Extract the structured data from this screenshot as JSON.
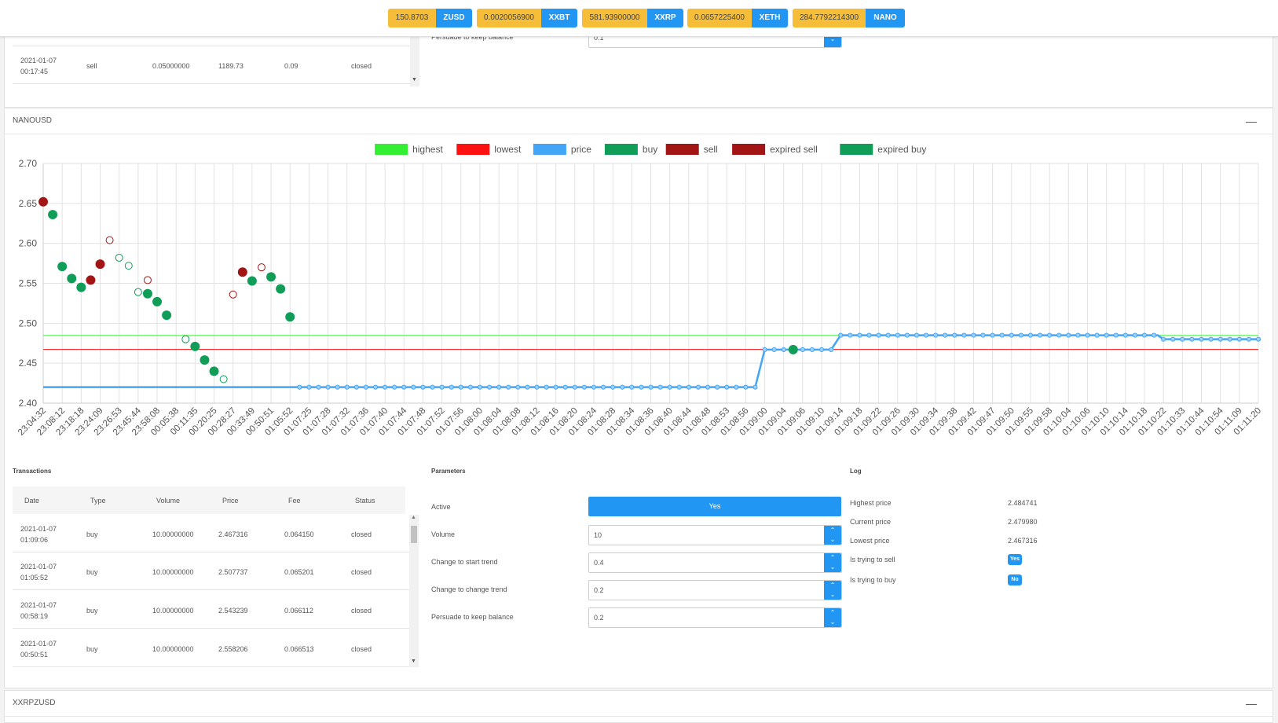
{
  "ticker": [
    {
      "value": "150.8703",
      "symbol": "ZUSD"
    },
    {
      "value": "0.0020056900",
      "symbol": "XXBT"
    },
    {
      "value": "581.93900000",
      "symbol": "XXRP"
    },
    {
      "value": "0.0657225400",
      "symbol": "XETH"
    },
    {
      "value": "284.7792214300",
      "symbol": "NANO"
    }
  ],
  "top_panel": {
    "row": {
      "date": "2021-01-07",
      "time": "00:17:45",
      "type": "sell",
      "volume": "0.05000000",
      "price": "1189.73",
      "fee": "0.09",
      "status": "closed"
    },
    "param_label": "Persuade to keep balance",
    "param_value": "0.1"
  },
  "nanousd": {
    "title": "NANOUSD",
    "collapse_label": "—",
    "transactions": {
      "title": "Transactions",
      "headers": [
        "Date",
        "Type",
        "Volume",
        "Price",
        "Fee",
        "Status"
      ],
      "rows": [
        {
          "date": "2021-01-07",
          "time": "01:09:06",
          "type": "buy",
          "volume": "10.00000000",
          "price": "2.467316",
          "fee": "0.064150",
          "status": "closed"
        },
        {
          "date": "2021-01-07",
          "time": "01:05:52",
          "type": "buy",
          "volume": "10.00000000",
          "price": "2.507737",
          "fee": "0.065201",
          "status": "closed"
        },
        {
          "date": "2021-01-07",
          "time": "00:58:19",
          "type": "buy",
          "volume": "10.00000000",
          "price": "2.543239",
          "fee": "0.066112",
          "status": "closed"
        },
        {
          "date": "2021-01-07",
          "time": "00:50:51",
          "type": "buy",
          "volume": "10.00000000",
          "price": "2.558206",
          "fee": "0.066513",
          "status": "closed"
        }
      ]
    },
    "parameters": {
      "title": "Parameters",
      "active_label": "Active",
      "active_value": "Yes",
      "fields": [
        {
          "label": "Volume",
          "value": "10"
        },
        {
          "label": "Change to start trend",
          "value": "0.4"
        },
        {
          "label": "Change to change trend",
          "value": "0.2"
        },
        {
          "label": "Persuade to keep balance",
          "value": "0.2"
        }
      ]
    },
    "log": {
      "title": "Log",
      "items": [
        {
          "label": "Highest price",
          "value": "2.484741"
        },
        {
          "label": "Current price",
          "value": "2.479980"
        },
        {
          "label": "Lowest price",
          "value": "2.467316"
        }
      ],
      "flags": [
        {
          "label": "Is trying to sell",
          "value": "Yes"
        },
        {
          "label": "Is trying to buy",
          "value": "No"
        }
      ]
    }
  },
  "bottom_panel": {
    "title": "XXRPZUSD",
    "collapse_label": "—"
  },
  "chart_data": {
    "type": "line",
    "ylim": [
      2.4,
      2.7
    ],
    "yticks": [
      "2.40",
      "2.45",
      "2.50",
      "2.55",
      "2.60",
      "2.65",
      "2.70"
    ],
    "categories": [
      "23:04:32",
      "23:08:12",
      "23:18:18",
      "23:24:09",
      "23:26:53",
      "23:45:44",
      "23:58:08",
      "00:05:38",
      "00:11:35",
      "00:20:25",
      "00:28:27",
      "00:33:49",
      "00:50:51",
      "01:05:52",
      "01:07:25",
      "01:07:28",
      "01:07:32",
      "01:07:36",
      "01:07:40",
      "01:07:44",
      "01:07:48",
      "01:07:52",
      "01:07:56",
      "01:08:00",
      "01:08:04",
      "01:08:08",
      "01:08:12",
      "01:08:16",
      "01:08:20",
      "01:08:24",
      "01:08:28",
      "01:08:34",
      "01:08:36",
      "01:08:40",
      "01:08:44",
      "01:08:48",
      "01:08:53",
      "01:08:56",
      "01:09:00",
      "01:09:04",
      "01:09:06",
      "01:09:10",
      "01:09:14",
      "01:09:18",
      "01:09:22",
      "01:09:26",
      "01:09:30",
      "01:09:34",
      "01:09:38",
      "01:09:42",
      "01:09:47",
      "01:09:50",
      "01:09:55",
      "01:09:58",
      "01:10:04",
      "01:10:06",
      "01:10:10",
      "01:10:14",
      "01:10:18",
      "01:10:22",
      "01:10:33",
      "01:10:44",
      "01:10:54",
      "01:11:09",
      "01:11:20"
    ],
    "legend": [
      {
        "name": "highest",
        "color": "#33ee33"
      },
      {
        "name": "lowest",
        "color": "#ff1111"
      },
      {
        "name": "price",
        "color": "#42a5f5"
      },
      {
        "name": "buy",
        "color": "#0f9d58"
      },
      {
        "name": "sell",
        "color": "#a31515"
      },
      {
        "name": "expired sell",
        "color": "#a31515"
      },
      {
        "name": "expired buy",
        "color": "#0f9d58"
      }
    ],
    "highest": 2.4847,
    "lowest": 2.4673,
    "price": [
      {
        "x": 0,
        "y": 2.42
      },
      {
        "x": 37.5,
        "y": 2.42
      },
      {
        "x": 38,
        "y": 2.467
      },
      {
        "x": 41.5,
        "y": 2.467
      },
      {
        "x": 42,
        "y": 2.485
      },
      {
        "x": 58.7,
        "y": 2.485
      },
      {
        "x": 59,
        "y": 2.48
      },
      {
        "x": 64,
        "y": 2.48
      }
    ],
    "price_points_start": 13.5,
    "price_points_step": 0.5,
    "buy": [
      {
        "x": 0.5,
        "y": 2.636
      },
      {
        "x": 1,
        "y": 2.571
      },
      {
        "x": 1.5,
        "y": 2.556
      },
      {
        "x": 2,
        "y": 2.545
      },
      {
        "x": 5.5,
        "y": 2.537
      },
      {
        "x": 6,
        "y": 2.527
      },
      {
        "x": 6.5,
        "y": 2.51
      },
      {
        "x": 8,
        "y": 2.471
      },
      {
        "x": 8.5,
        "y": 2.454
      },
      {
        "x": 9,
        "y": 2.44
      },
      {
        "x": 11,
        "y": 2.553
      },
      {
        "x": 12,
        "y": 2.558
      },
      {
        "x": 12.5,
        "y": 2.543
      },
      {
        "x": 13,
        "y": 2.508
      },
      {
        "x": 39.5,
        "y": 2.467
      }
    ],
    "sell": [
      {
        "x": 0,
        "y": 2.652
      },
      {
        "x": 2.5,
        "y": 2.554
      },
      {
        "x": 3,
        "y": 2.574
      },
      {
        "x": 10.5,
        "y": 2.564
      }
    ],
    "expired_sell": [
      {
        "x": 3.5,
        "y": 2.604
      },
      {
        "x": 5.5,
        "y": 2.554
      },
      {
        "x": 10,
        "y": 2.536
      },
      {
        "x": 11.5,
        "y": 2.57
      }
    ],
    "expired_buy": [
      {
        "x": 4,
        "y": 2.582
      },
      {
        "x": 4.5,
        "y": 2.572
      },
      {
        "x": 5,
        "y": 2.539
      },
      {
        "x": 7.5,
        "y": 2.48
      },
      {
        "x": 9.5,
        "y": 2.43
      }
    ]
  }
}
